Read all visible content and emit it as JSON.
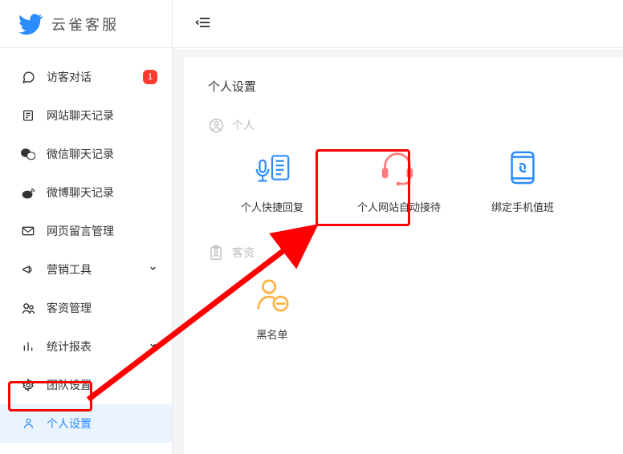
{
  "brand": {
    "name": "云雀客服"
  },
  "sidebar": {
    "items": [
      {
        "label": "访客对话",
        "badge": "1"
      },
      {
        "label": "网站聊天记录"
      },
      {
        "label": "微信聊天记录"
      },
      {
        "label": "微博聊天记录"
      },
      {
        "label": "网页留言管理"
      },
      {
        "label": "营销工具",
        "expandable": true
      },
      {
        "label": "客资管理"
      },
      {
        "label": "统计报表",
        "expandable": true
      },
      {
        "label": "团队设置"
      },
      {
        "label": "个人设置",
        "active": true
      }
    ]
  },
  "panel": {
    "title": "个人设置",
    "sections": [
      {
        "name": "个人",
        "tiles": [
          {
            "label": "个人快捷回复"
          },
          {
            "label": "个人网站自动接待"
          },
          {
            "label": "绑定手机值班"
          }
        ]
      },
      {
        "name": "客资",
        "tiles": [
          {
            "label": "黑名单"
          }
        ]
      }
    ]
  }
}
